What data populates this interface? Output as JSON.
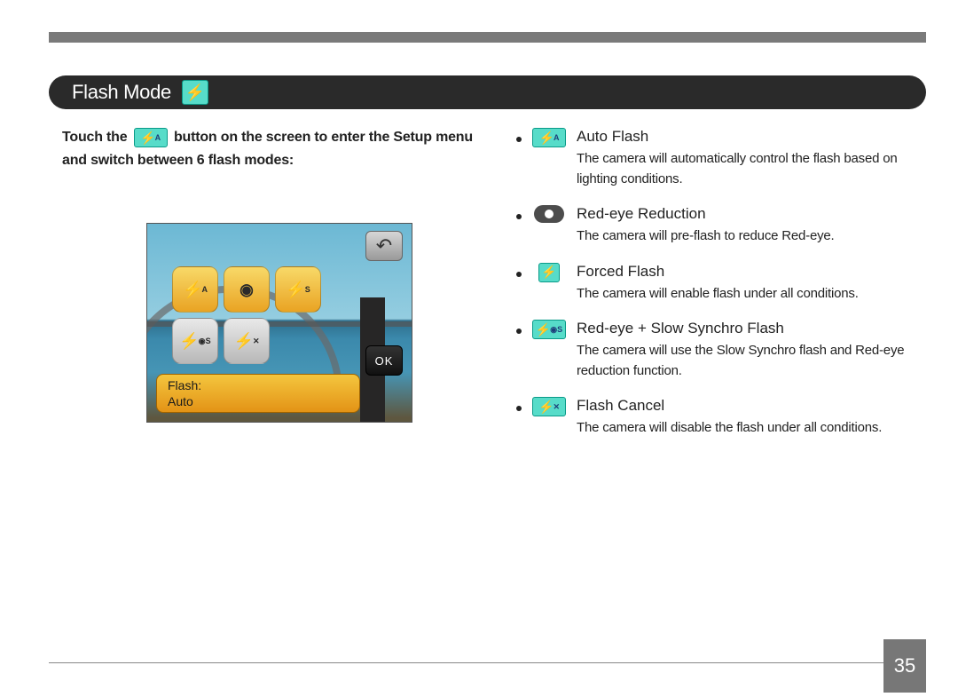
{
  "page_number": "35",
  "header": {
    "title": "Flash Mode",
    "icon": "flash-icon"
  },
  "intro": {
    "before": "Touch the",
    "after": "button on the screen to enter the Setup menu and switch between 6 flash modes:",
    "icon": "flash-auto-icon"
  },
  "camera_preview": {
    "back_label": "↶",
    "ok_label": "OK",
    "status_label": "Flash:",
    "status_value": "Auto",
    "row1_icons": [
      "flash-auto",
      "red-eye",
      "flash-slow"
    ],
    "row2_icons": [
      "red-eye-slow",
      "flash-cancel"
    ]
  },
  "modes": [
    {
      "icon": "flash-auto-icon",
      "title": "Auto Flash",
      "desc": "The camera will automatically control the flash based on lighting conditions."
    },
    {
      "icon": "eye-icon",
      "title": "Red-eye Reduction",
      "desc": "The camera will pre-flash to reduce Red-eye."
    },
    {
      "icon": "flash-icon",
      "title": "Forced Flash",
      "desc": "The camera will enable flash under all conditions."
    },
    {
      "icon": "flash-slow-redeye-icon",
      "title": "Red-eye + Slow Synchro Flash",
      "desc": "The camera will use the Slow Synchro flash and Red-eye reduction function."
    },
    {
      "icon": "flash-cancel-icon",
      "title": "Flash Cancel",
      "desc": "The camera will disable the flash under all conditions."
    }
  ]
}
